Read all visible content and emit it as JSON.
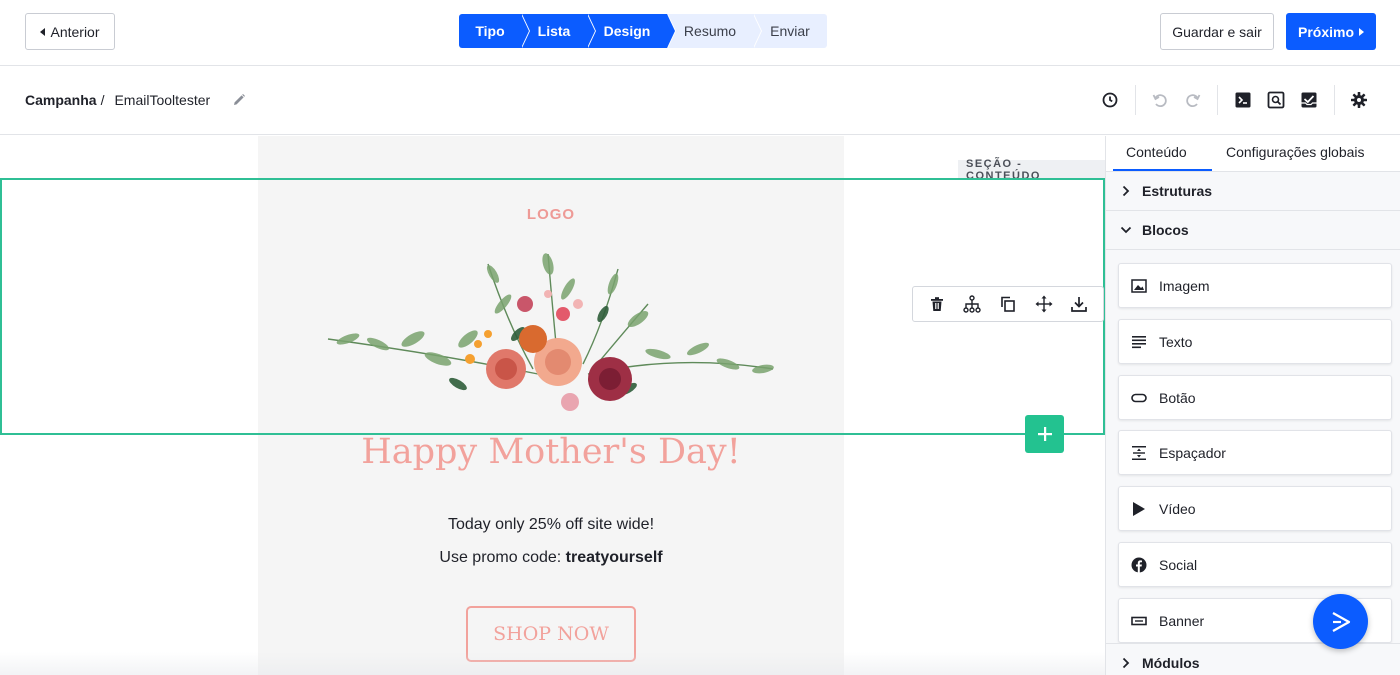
{
  "topbar": {
    "prev_label": "Anterior",
    "save_exit_label": "Guardar e sair",
    "next_label": "Próximo",
    "steps": [
      {
        "label": "Tipo",
        "active": true
      },
      {
        "label": "Lista",
        "active": true
      },
      {
        "label": "Design",
        "active": true
      },
      {
        "label": "Resumo",
        "active": false
      },
      {
        "label": "Enviar",
        "active": false
      }
    ]
  },
  "breadcrumb": {
    "root": "Campanha",
    "separator": "/",
    "name": "EmailTooltester"
  },
  "toolbar_icons": [
    "history-icon",
    "undo-icon",
    "redo-icon",
    "code-icon",
    "preview-icon",
    "test-email-icon",
    "settings-icon"
  ],
  "canvas": {
    "section_tag": "SEÇÃO - CONTEÚDO",
    "email": {
      "logo": "LOGO",
      "heading": "Happy Mother's Day!",
      "line1": "Today only 25% off site wide!",
      "line2_prefix": "Use promo code: ",
      "promo_code": "treatyourself",
      "button": "SHOP NOW"
    },
    "section_actions": [
      "delete-icon",
      "structure-icon",
      "duplicate-icon",
      "move-icon",
      "save-icon"
    ]
  },
  "sidebar": {
    "tabs": [
      {
        "label": "Conteúdo",
        "active": true
      },
      {
        "label": "Configurações globais",
        "active": false
      }
    ],
    "sections": {
      "structures": "Estruturas",
      "blocks": "Blocos",
      "modules": "Módulos"
    },
    "blocks": [
      {
        "label": "Imagem",
        "icon": "image-icon"
      },
      {
        "label": "Texto",
        "icon": "text-icon"
      },
      {
        "label": "Botão",
        "icon": "button-icon"
      },
      {
        "label": "Espaçador",
        "icon": "spacer-icon"
      },
      {
        "label": "Vídeo",
        "icon": "video-icon"
      },
      {
        "label": "Social",
        "icon": "facebook-icon"
      },
      {
        "label": "Banner",
        "icon": "banner-icon"
      }
    ]
  },
  "colors": {
    "primary": "#0b5cff",
    "accent_green": "#23c290",
    "frame_green": "#2fbf95",
    "salmon": "#f2a29c"
  }
}
